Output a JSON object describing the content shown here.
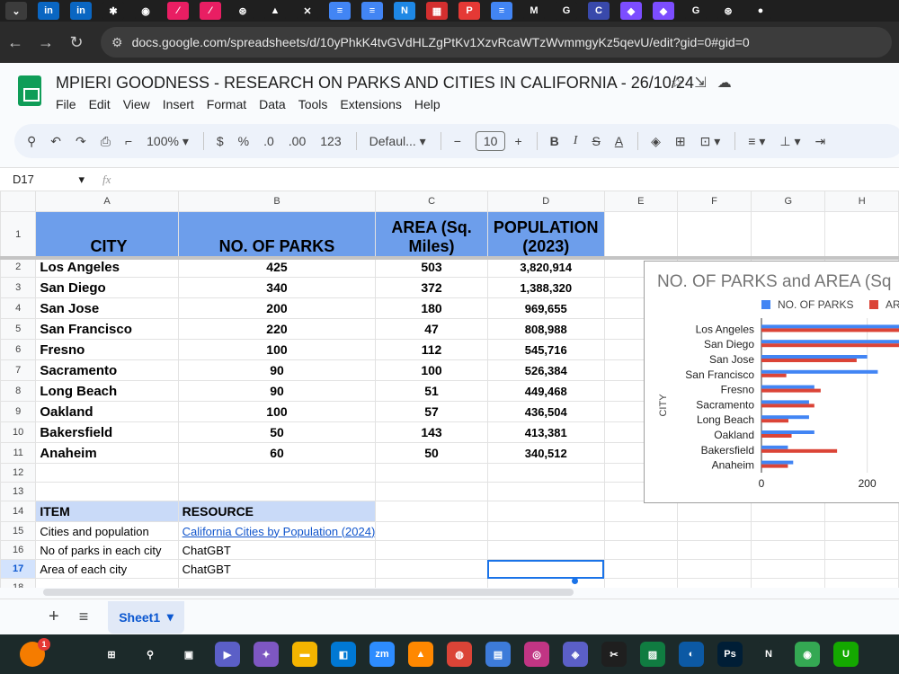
{
  "browser": {
    "url": "docs.google.com/spreadsheets/d/10yPhkK4tvGVdHLZgPtKv1XzvRcaWTzWvmmgyKz5qevU/edit?gid=0#gid=0",
    "back_icon": "←",
    "forward_icon": "→",
    "reload_icon": "↻",
    "tabs": [
      {
        "icon": "down-chevron",
        "text": "⌄",
        "color": "#3c3c3c"
      },
      {
        "icon": "linkedin",
        "text": "in",
        "color": "#0a66c2"
      },
      {
        "icon": "linkedin",
        "text": "in",
        "color": "#0a66c2"
      },
      {
        "icon": "asterisk",
        "text": "✱",
        "color": "#1f1f1f"
      },
      {
        "icon": "globe",
        "text": "◉",
        "color": "#1f1f1f"
      },
      {
        "icon": "app-pink",
        "text": "⁄",
        "color": "#e91e63"
      },
      {
        "icon": "app-pink",
        "text": "⁄",
        "color": "#e91e63"
      },
      {
        "icon": "openai",
        "text": "⊛",
        "color": "#1f1f1f"
      },
      {
        "icon": "drive",
        "text": "▲",
        "color": "#1f1f1f"
      },
      {
        "icon": "close",
        "text": "✕",
        "color": "#1f1f1f"
      },
      {
        "icon": "docs",
        "text": "≡",
        "color": "#4285f4"
      },
      {
        "icon": "docs",
        "text": "≡",
        "color": "#4285f4"
      },
      {
        "icon": "app-n",
        "text": "N",
        "color": "#1e88e5"
      },
      {
        "icon": "grid-app",
        "text": "▦",
        "color": "#d32f2f"
      },
      {
        "icon": "app-p",
        "text": "P",
        "color": "#e53935"
      },
      {
        "icon": "docs",
        "text": "≡",
        "color": "#4285f4"
      },
      {
        "icon": "gmail",
        "text": "M",
        "color": "#1f1f1f"
      },
      {
        "icon": "google",
        "text": "G",
        "color": "#1f1f1f"
      },
      {
        "icon": "chrome-c",
        "text": "C",
        "color": "#3949ab"
      },
      {
        "icon": "shield",
        "text": "◆",
        "color": "#7c4dff"
      },
      {
        "icon": "shield",
        "text": "◆",
        "color": "#7c4dff"
      },
      {
        "icon": "google",
        "text": "G",
        "color": "#1f1f1f"
      },
      {
        "icon": "openai",
        "text": "⊛",
        "color": "#1f1f1f"
      },
      {
        "icon": "github",
        "text": "●",
        "color": "#1f1f1f"
      }
    ]
  },
  "document": {
    "title": "MPIERI GOODNESS - RESEARCH ON  PARKS AND CITIES IN CALIFORNIA - 26/10/24",
    "menu": [
      "File",
      "Edit",
      "View",
      "Insert",
      "Format",
      "Data",
      "Tools",
      "Extensions",
      "Help"
    ]
  },
  "toolbar": {
    "zoom": "100%",
    "font": "Defaul...",
    "font_size": "10",
    "currency": "$",
    "percent": "%",
    "dec_decrease": ".0",
    "dec_increase": ".00",
    "number_format": "123"
  },
  "formula_bar": {
    "cell_ref": "D17",
    "fx": "fx"
  },
  "columns": [
    "A",
    "B",
    "C",
    "D",
    "E",
    "F",
    "G",
    "H"
  ],
  "rows": [
    "1",
    "2",
    "3",
    "4",
    "5",
    "6",
    "7",
    "8",
    "9",
    "10",
    "11",
    "12",
    "13",
    "14",
    "15",
    "16",
    "17",
    "18"
  ],
  "table": {
    "headers": [
      "CITY",
      "NO. OF PARKS",
      "AREA (Sq. Miles)",
      "POPULATION (2023)"
    ],
    "data": [
      [
        "Los Angeles",
        "425",
        "503",
        "3,820,914"
      ],
      [
        "San Diego",
        "340",
        "372",
        "1,388,320"
      ],
      [
        "San Jose",
        "200",
        "180",
        "969,655"
      ],
      [
        "San Francisco",
        "220",
        "47",
        "808,988"
      ],
      [
        "Fresno",
        "100",
        "112",
        "545,716"
      ],
      [
        "Sacramento",
        "90",
        "100",
        "526,384"
      ],
      [
        "Long Beach",
        "90",
        "51",
        "449,468"
      ],
      [
        "Oakland",
        "100",
        "57",
        "436,504"
      ],
      [
        "Bakersfield",
        "50",
        "143",
        "413,381"
      ],
      [
        "Anaheim",
        "60",
        "50",
        "340,512"
      ]
    ]
  },
  "resources": {
    "header_item": "ITEM",
    "header_resource": "RESOURCE",
    "rows": [
      {
        "item": "Cities and population",
        "resource": "California Cities by Population (2024)"
      },
      {
        "item": "No of parks in each city",
        "resource": "ChatGBT"
      },
      {
        "item": "Area of each city",
        "resource": "ChatGBT"
      }
    ]
  },
  "sheet_tab": {
    "name": "Sheet1",
    "add": "+",
    "list": "≡",
    "dropdown": "▾"
  },
  "chart_data": {
    "type": "bar",
    "orientation": "horizontal",
    "title": "NO. OF PARKS and AREA (Sq",
    "ylabel": "CITY",
    "xlabel": "",
    "categories": [
      "Los Angeles",
      "San Diego",
      "San Jose",
      "San Francisco",
      "Fresno",
      "Sacramento",
      "Long Beach",
      "Oakland",
      "Bakersfield",
      "Anaheim"
    ],
    "series": [
      {
        "name": "NO. OF PARKS",
        "values": [
          425,
          340,
          200,
          220,
          100,
          90,
          90,
          100,
          50,
          60
        ],
        "color": "#4285f4"
      },
      {
        "name": "AR",
        "values": [
          503,
          372,
          180,
          47,
          112,
          100,
          51,
          57,
          143,
          50
        ],
        "color": "#db4437"
      }
    ],
    "xticks": [
      "0",
      "200"
    ],
    "xlim": [
      0,
      272
    ],
    "legend": "top"
  },
  "taskbar": {
    "notification_count": "1",
    "icons": [
      {
        "name": "windows-start",
        "text": "⊞",
        "color": "#1c2a2a"
      },
      {
        "name": "search",
        "text": "⚲",
        "color": "#1c2a2a"
      },
      {
        "name": "task-view",
        "text": "▣",
        "color": "#1c2a2a"
      },
      {
        "name": "meet",
        "text": "▶",
        "color": "#5b5fc7"
      },
      {
        "name": "copilot",
        "text": "✦",
        "color": "#7e57c2"
      },
      {
        "name": "file-explorer",
        "text": "▬",
        "color": "#f4b400"
      },
      {
        "name": "store",
        "text": "◧",
        "color": "#0078d4"
      },
      {
        "name": "zoom",
        "text": "zm",
        "color": "#2d8cff"
      },
      {
        "name": "vlc",
        "text": "▲",
        "color": "#ff8800"
      },
      {
        "name": "chrome-alt",
        "text": "◍",
        "color": "#db4437"
      },
      {
        "name": "notepad",
        "text": "▤",
        "color": "#3d7bd9"
      },
      {
        "name": "instagram",
        "text": "◎",
        "color": "#c13584"
      },
      {
        "name": "edge-copilot",
        "text": "◈",
        "color": "#5b5fc7"
      },
      {
        "name": "capcut",
        "text": "✂",
        "color": "#1f1f1f"
      },
      {
        "name": "photos",
        "text": "▨",
        "color": "#107c41"
      },
      {
        "name": "edge",
        "text": "◐",
        "color": "#0c59a4"
      },
      {
        "name": "photoshop",
        "text": "Ps",
        "color": "#001e36"
      },
      {
        "name": "netflix",
        "text": "N",
        "color": "#1c2a2a"
      },
      {
        "name": "chrome",
        "text": "◉",
        "color": "#34a853"
      },
      {
        "name": "upwork",
        "text": "U",
        "color": "#14a800"
      }
    ]
  }
}
